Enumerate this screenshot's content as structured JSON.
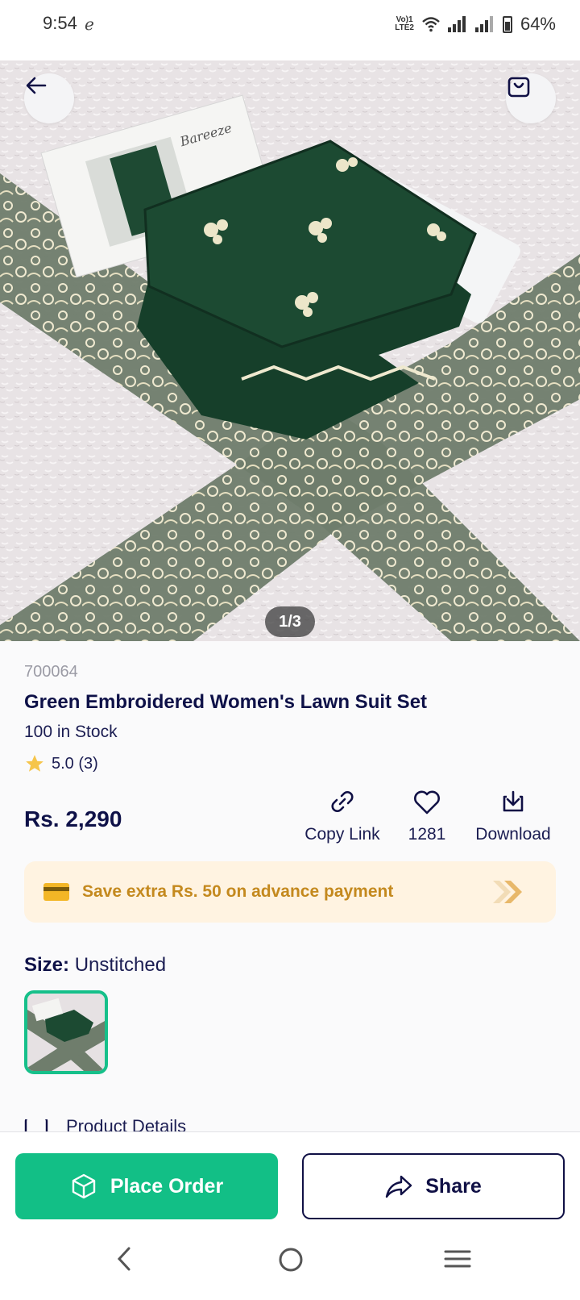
{
  "status_bar": {
    "time": "9:54",
    "network": "Vo) LTE2",
    "battery": "64%"
  },
  "hero": {
    "page_indicator": "1/3",
    "brand_watermark": "Bareeze"
  },
  "product": {
    "sku": "700064",
    "title": "Green Embroidered Women's Lawn Suit Set",
    "stock": "100 in Stock",
    "rating": "5.0 (3)",
    "price": "Rs. 2,290"
  },
  "actions": {
    "copy_link": "Copy Link",
    "likes": "1281",
    "download": "Download"
  },
  "promo": {
    "text": "Save extra Rs. 50 on advance payment"
  },
  "size": {
    "label": "Size:",
    "value": "Unstitched"
  },
  "details_peek": "Product Details",
  "bottom_bar": {
    "place_order": "Place Order",
    "share": "Share"
  },
  "colors": {
    "accent": "#12BF86",
    "navy": "#101045",
    "promo_bg": "#FFF3E1",
    "promo_text": "#C4891E"
  },
  "icons": [
    "back-arrow-icon",
    "shopping-bag-icon",
    "star-icon",
    "link-icon",
    "heart-icon",
    "download-icon",
    "card-icon",
    "chevrons-icon",
    "cube-icon",
    "share-icon"
  ]
}
